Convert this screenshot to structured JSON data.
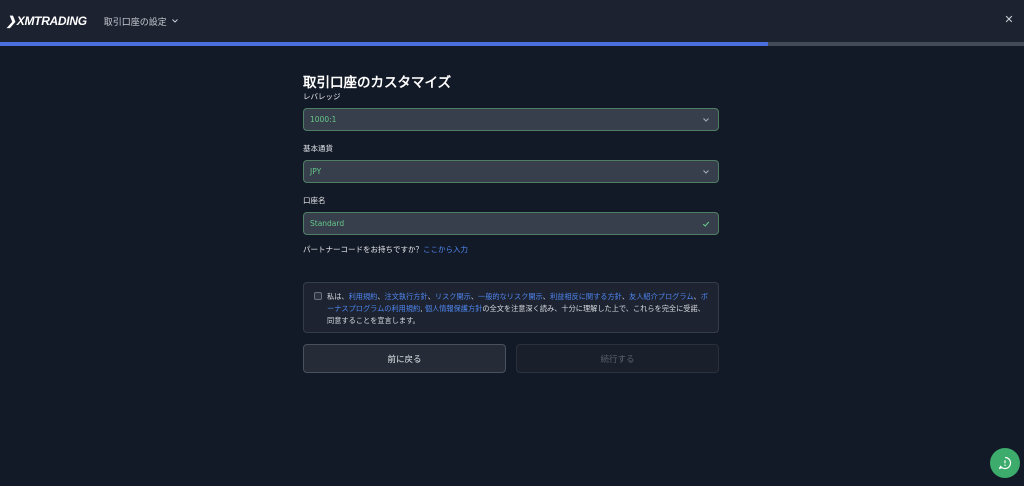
{
  "header": {
    "logo_text": "XMTRADING",
    "breadcrumb": "取引口座の設定"
  },
  "progress": {
    "fraction": 0.75
  },
  "form": {
    "title": "取引口座のカスタマイズ",
    "leverage": {
      "label": "レバレッジ",
      "value": "1000:1"
    },
    "currency": {
      "label": "基本通貨",
      "value": "JPY"
    },
    "account_name": {
      "label": "口座名",
      "value": "Standard"
    },
    "partner": {
      "question": "パートナーコードをお持ちですか？",
      "link": "ここから入力"
    }
  },
  "terms": {
    "prefix": "私は、",
    "links": [
      "利用規約",
      "注文執行方針",
      "リスク開示",
      "一般的なリスク開示",
      "利益相反に関する方針",
      "友人紹介プログラム",
      "ボーナスプログラムの利用規約",
      "個人情報保護方針"
    ],
    "suffix": "の全文を注意深く読み、十分に理解した上で、これらを完全に受諾、同意することを宣言します。"
  },
  "buttons": {
    "back": "前に戻る",
    "next": "続行する"
  },
  "colors": {
    "accent": "#4a70e0",
    "success": "#63c789",
    "link": "#4f86f0",
    "chat": "#3cab6c"
  },
  "icons": [
    "chevron-down-icon",
    "close-icon",
    "check-icon",
    "chat-icon"
  ]
}
